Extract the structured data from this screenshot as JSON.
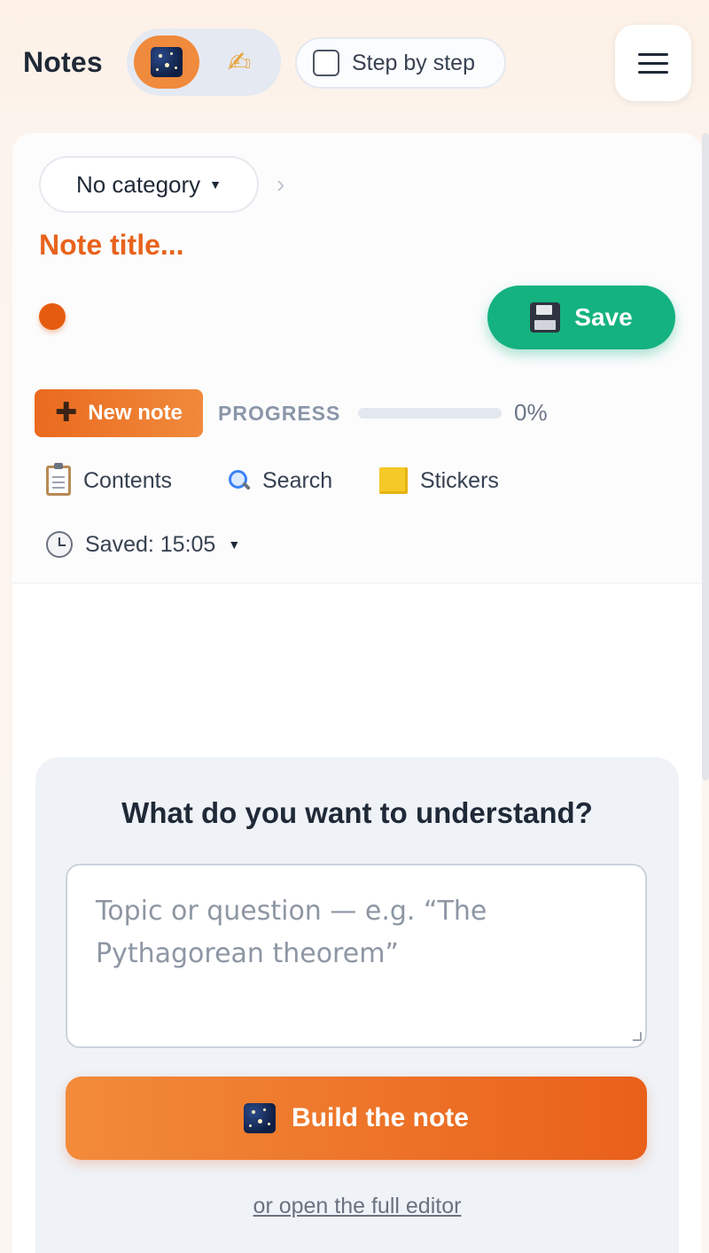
{
  "header": {
    "title": "Notes",
    "mode_ai_icon": "stars-icon",
    "mode_write_icon": "pencil-icon",
    "mode_write_glyph": "✍",
    "step_by_step": {
      "label": "Step by step",
      "checked": false
    },
    "menu_icon": "hamburger-menu-icon"
  },
  "note": {
    "category": "No category",
    "title_placeholder": "Note title...",
    "save_label": "Save",
    "new_note_label": "New note",
    "progress_label": "PROGRESS",
    "progress_fraction": 0,
    "progress_value": "0%",
    "tools": {
      "contents": "Contents",
      "search": "Search",
      "stickers": "Stickers"
    },
    "saved_label": "Saved: 15:05"
  },
  "prompt": {
    "heading": "What do you want to understand?",
    "placeholder": "Topic or question — e.g. “The Pythagorean theorem”",
    "build_label": "Build the note",
    "editor_link": "or open the full editor"
  },
  "colors": {
    "accent": "#f08a3c",
    "title": "#e8631c",
    "save": "#14b27f"
  }
}
